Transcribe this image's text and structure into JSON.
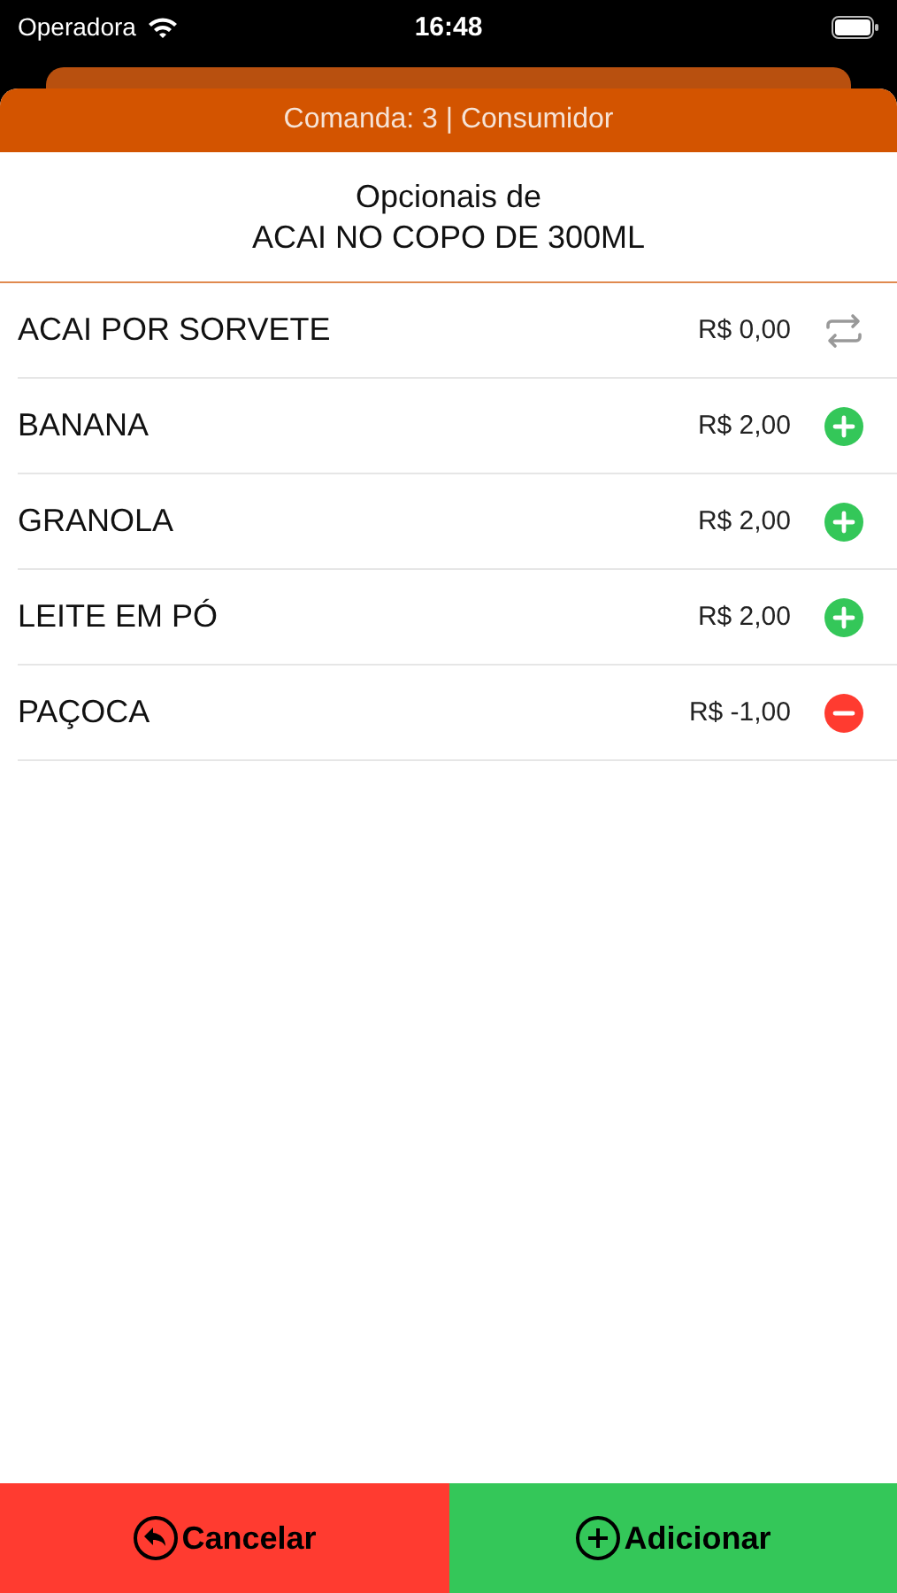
{
  "status_bar": {
    "carrier": "Operadora",
    "time": "16:48"
  },
  "sheet": {
    "title": "Comanda: 3 | Consumidor"
  },
  "heading": {
    "line1": "Opcionais de",
    "line2": "ACAI NO COPO DE 300ML"
  },
  "options": [
    {
      "name": "ACAI POR SORVETE",
      "price": "R$ 0,00",
      "kind": "swap"
    },
    {
      "name": "BANANA",
      "price": "R$ 2,00",
      "kind": "add"
    },
    {
      "name": "GRANOLA",
      "price": "R$ 2,00",
      "kind": "add"
    },
    {
      "name": "LEITE EM PÓ",
      "price": "R$ 2,00",
      "kind": "add"
    },
    {
      "name": "PAÇOCA",
      "price": "R$ -1,00",
      "kind": "remove"
    }
  ],
  "buttons": [
    {
      "label": "Cancelar",
      "kind": "cancel"
    },
    {
      "label": "Adicionar",
      "kind": "add"
    }
  ]
}
